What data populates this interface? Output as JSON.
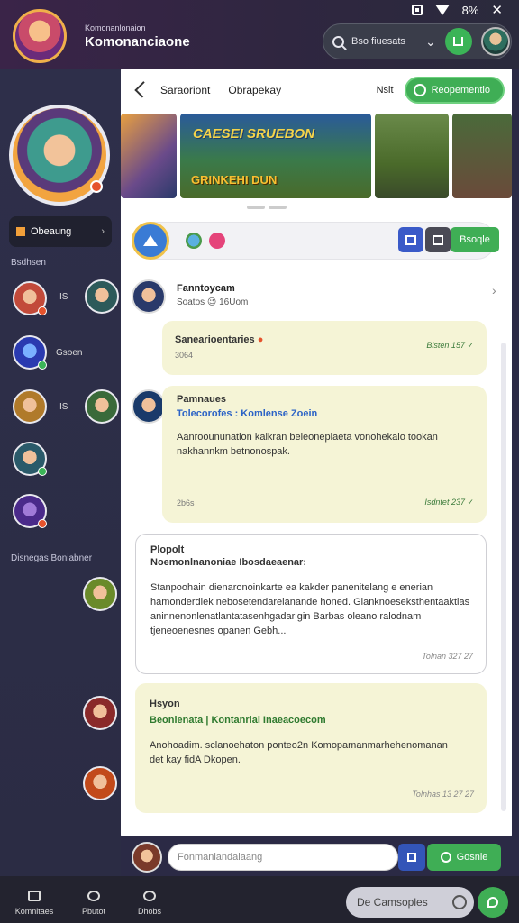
{
  "status": {
    "battery": "8%",
    "close": "✕"
  },
  "app": {
    "subtitle": "Komonanlonaion",
    "title": "Komonanciaone"
  },
  "top_search": {
    "text": "Bso fiuesats",
    "chevron": "⌄"
  },
  "sidebar": {
    "button_label": "Obeaung",
    "button_arrow": "›",
    "section1": "Bsdhsen",
    "section2": "Disnegas Boniabner",
    "items": [
      {
        "num": "IS",
        "label": ""
      },
      {
        "num": "",
        "label": "Gsoen"
      },
      {
        "num": "IS",
        "label": ""
      }
    ]
  },
  "header": {
    "item1": "Saraoriont",
    "item2": "Obrapekay",
    "item3": "Nsit",
    "action": "Reopementio"
  },
  "banner": {
    "title": "CAESEI SRUEBON",
    "subtitle": "GRINKEHI DUN"
  },
  "compose": {
    "post_label": "Bsoqle"
  },
  "feed": [
    {
      "name": "Fanntoycam",
      "sub": "Soatos 😉 16Uom"
    },
    {
      "title": "Sanearioentaries",
      "sub": "3064",
      "time": "Bisten 157 ✓"
    },
    {
      "name": "Pamnaues",
      "tag": "Tolecorofes : Komlense Zoein",
      "body": "Aanrooununation kaikran beleoneplaeta vonohekaio tookan nakhannkm betnonospak.",
      "time": "Isdntet 237 ✓",
      "sub": "2b6s"
    },
    {
      "name": "Plopolt",
      "title": "Noemonlnanoniae Ibosdaeaenar:",
      "body": "Stanpoohain dienaronoinkarte ea kakder panenitelang e enerian hamonderdlek nebosetendarelanande honed. Gianknoeseksthentaaktias aninnenonlenatlantatasenhgadarigin Barbas oleano ralodnam tjeneoenesnes opanen Gebh...",
      "time": "Tolnan 327 27"
    },
    {
      "name": "Hsyon",
      "tag": "Beonlenata | Kontanrial Inaeacoecom",
      "body": "Anohoadim. sclanoehaton ponteo2n Komopamanmarhehenomanan det kay fidA Dkopen.",
      "time": "Tolnhas 13 27 27"
    }
  ],
  "composer2": {
    "placeholder": "Fonmanlandalaang",
    "send_label": "Gosnie"
  },
  "bottom_nav": [
    {
      "label": "Komnitaes"
    },
    {
      "label": "Pbutot"
    },
    {
      "label": "Dhobs"
    }
  ],
  "bottom_pill": "De Camsoples"
}
